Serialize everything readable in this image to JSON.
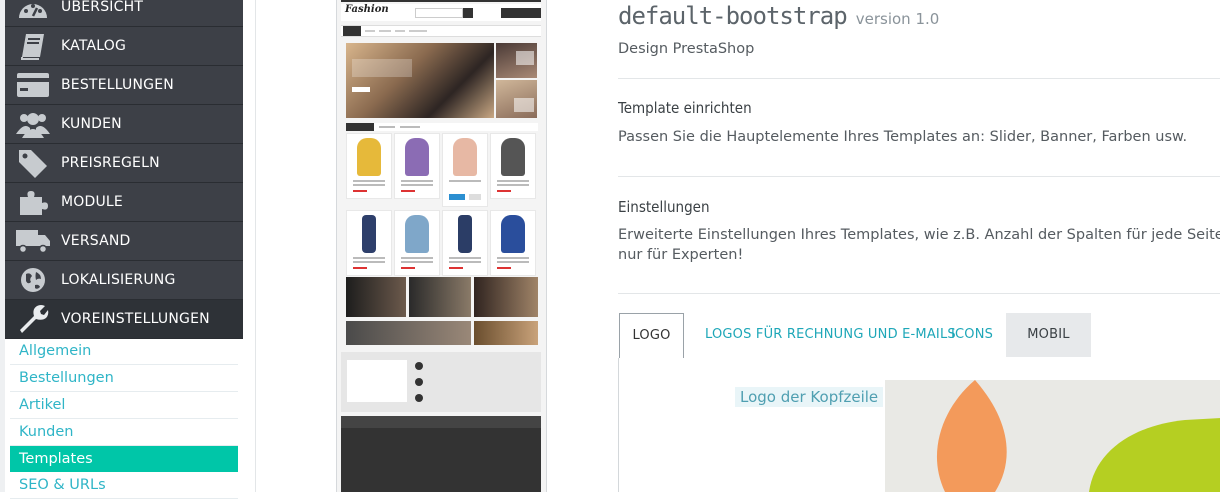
{
  "sidebar": {
    "menu": [
      {
        "label": "ÜBERSICHT",
        "icon": "dashboard-icon"
      },
      {
        "label": "KATALOG",
        "icon": "book-icon"
      },
      {
        "label": "BESTELLUNGEN",
        "icon": "credit-card-icon"
      },
      {
        "label": "KUNDEN",
        "icon": "users-icon"
      },
      {
        "label": "PREISREGELN",
        "icon": "tags-icon"
      },
      {
        "label": "MODULE",
        "icon": "puzzle-icon"
      },
      {
        "label": "VERSAND",
        "icon": "truck-icon"
      },
      {
        "label": "LOKALISIERUNG",
        "icon": "globe-icon"
      },
      {
        "label": "VOREINSTELLUNGEN",
        "icon": "wrench-icon"
      }
    ],
    "submenu": [
      "Allgemein",
      "Bestellungen",
      "Artikel",
      "Kunden",
      "Templates",
      "SEO & URLs"
    ],
    "active_submenu": "Templates"
  },
  "preview": {
    "logo_text": "Fashion"
  },
  "theme": {
    "name": "default-bootstrap",
    "version": "version 1.0",
    "designer": "Design PrestaShop"
  },
  "sections": [
    {
      "title": "Template einrichten",
      "desc": "Passen Sie die Hauptelemente Ihres Templates an: Slider, Banner, Farben usw."
    },
    {
      "title": "Einstellungen",
      "desc": "Erweiterte Einstellungen Ihres Templates, wie z.B. Anzahl der Spalten für jede Seite - emp",
      "desc2": "nur für Experten!"
    }
  ],
  "tabs": [
    "LOGO",
    "LOGOS FÜR RECHNUNG UND E-MAILS",
    "ICONS",
    "MOBIL"
  ],
  "panel": {
    "logo_label": "Logo der Kopfzeile"
  },
  "colors": {
    "accent": "#00c6a8",
    "link": "#1ea7b8",
    "sidebar": "#3d4047"
  }
}
